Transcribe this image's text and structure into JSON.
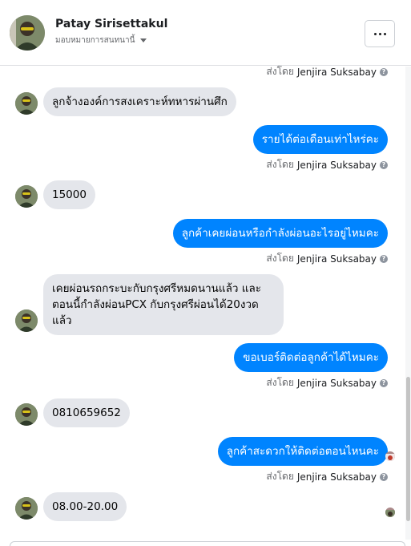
{
  "header": {
    "name": "Patay Sirisettakul",
    "subtitle": "มอบหมายการสนทนานี้",
    "avatar_icon": "user-avatar",
    "more_icon": "more-dots-icon"
  },
  "sent_by_label": "ส่งโดย",
  "agent_name": "Jenjira Suksabay",
  "messages": [
    {
      "text": "ลูกจ้างองค์การสงเคราะห์ทหารผ่านศึก"
    },
    {
      "text": "รายได้ต่อเดือนเท่าไหร่คะ"
    },
    {
      "text": "15000"
    },
    {
      "text": "ลูกค้าเคยผ่อนหรือกำลังผ่อนอะไรอยู่ไหมคะ"
    },
    {
      "line1": "เคยผ่อนรถกระบะกับกรุงศรีหมดนานแล้ว และ",
      "line2": "ตอนนี้กำลังผ่อนPCX กับกรุงศรีผ่อนได้20งวด",
      "line3": "แล้ว"
    },
    {
      "text": "ขอเบอร์ติดต่อลูกค้าได้ไหมคะ"
    },
    {
      "text": "0810659652"
    },
    {
      "text": "ลูกค้าสะดวกให้ติดต่อตอนไหนคะ"
    },
    {
      "text": "08.00-20.00"
    }
  ],
  "colors": {
    "outgoing_bubble": "#0084ff",
    "incoming_bubble": "#e4e6eb"
  }
}
